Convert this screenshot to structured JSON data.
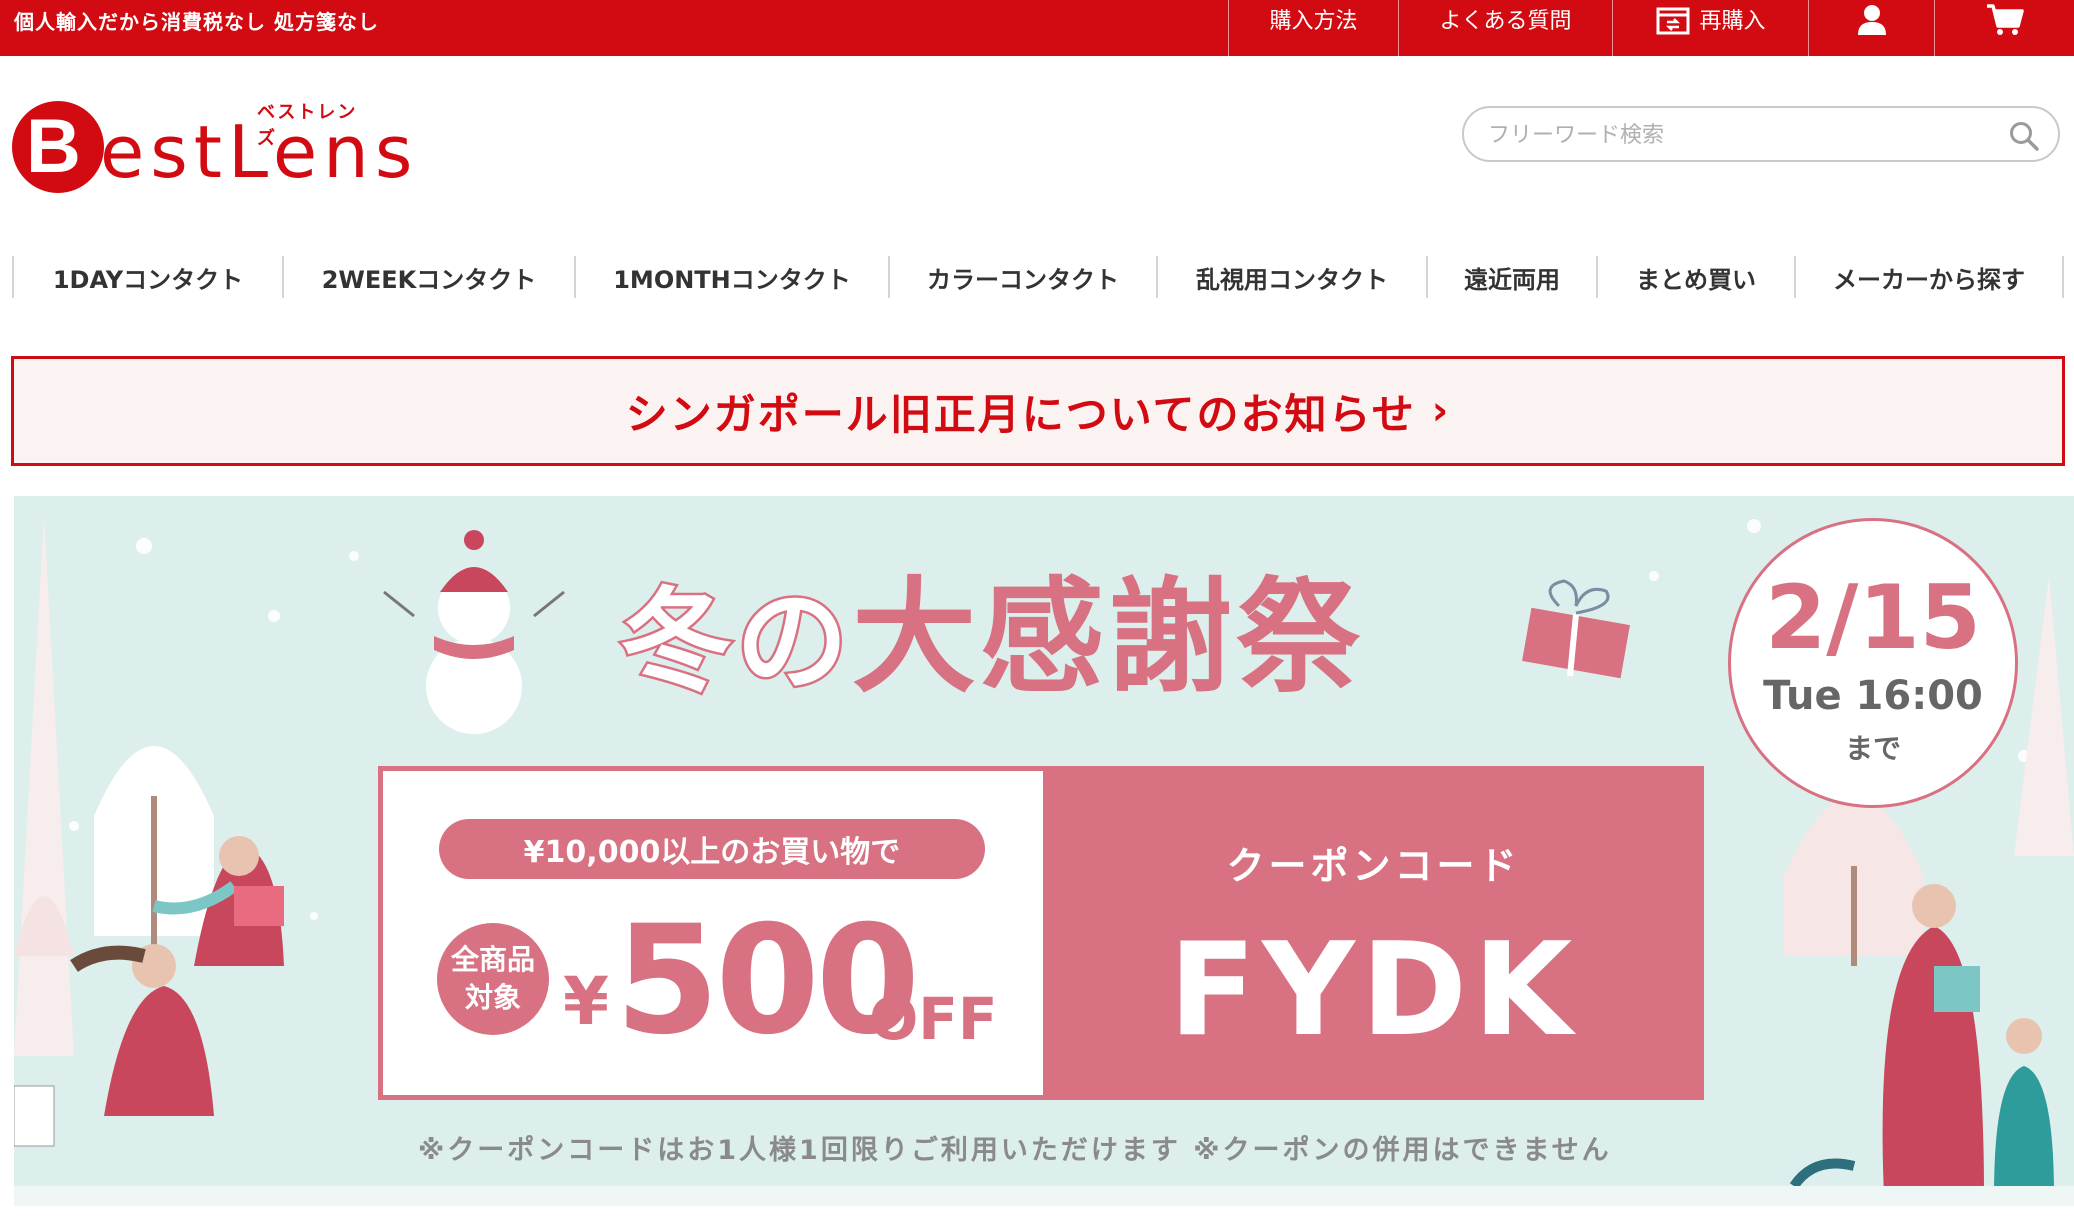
{
  "topbar": {
    "tagline": "個人輸入だから消費税なし 処方箋なし",
    "nav": {
      "how_to_buy": "購入方法",
      "faq": "よくある質問",
      "reorder": "再購入"
    },
    "icons": [
      "reorder-icon",
      "user-icon",
      "cart-icon"
    ]
  },
  "header": {
    "logo_text": "estLens",
    "logo_letter": "B",
    "logo_kana": "ベストレンズ",
    "search_placeholder": "フリーワード検索"
  },
  "categories": [
    "1DAYコンタクト",
    "2WEEKコンタクト",
    "1MONTHコンタクト",
    "カラーコンタクト",
    "乱視用コンタクト",
    "遠近両用",
    "まとめ買い",
    "メーカーから探す"
  ],
  "notice": {
    "text": "シンガポール旧正月についてのお知らせ",
    "chevron": "›"
  },
  "banner": {
    "title_part1": "冬",
    "title_part2": "の",
    "title_part3": "大感謝祭",
    "condition": "¥10,000以上のお買い物で",
    "badge_line1": "全商品",
    "badge_line2": "対象",
    "yen": "¥",
    "amount": "500",
    "off": "OFF",
    "code_label": "クーポンコード",
    "code": "FYDK",
    "deadline_date": "2/15",
    "deadline_time": "Tue 16:00",
    "deadline_until": "まで",
    "footnote": "※クーポンコードはお1人様1回限りご利用いただけます ※クーポンの併用はできません"
  },
  "colors": {
    "brand_red": "#d20a11",
    "banner_pink": "#d87182",
    "banner_bg": "#dcefec"
  }
}
